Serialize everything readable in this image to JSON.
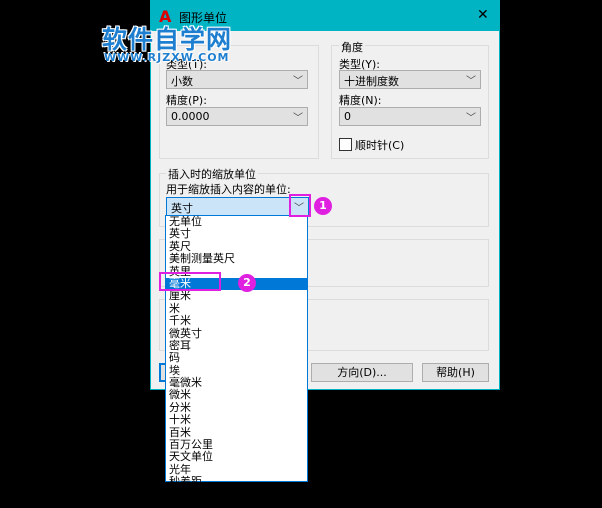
{
  "window": {
    "title": "图形单位",
    "close": "✕"
  },
  "watermark": {
    "name": "软件自学网",
    "url": "WWW.RJZXW.COM"
  },
  "length": {
    "type_label": "类型(T):",
    "type_value": "小数",
    "precision_label": "精度(P):",
    "precision_value": "0.0000"
  },
  "angle": {
    "group": "角度",
    "type_label": "类型(Y):",
    "type_value": "十进制度数",
    "precision_label": "精度(N):",
    "precision_value": "0",
    "clockwise_label": "顺时针(C)",
    "clockwise_checked": false
  },
  "insert": {
    "group": "插入时的缩放单位",
    "label": "用于缩放插入内容的单位:",
    "value": "英寸"
  },
  "dropdown": {
    "items": [
      "无单位",
      "英寸",
      "英尺",
      "美制测量英尺",
      "英里",
      "毫米",
      "厘米",
      "米",
      "千米",
      "微英寸",
      "密耳",
      "码",
      "埃",
      "毫微米",
      "微米",
      "分米",
      "十米",
      "百米",
      "百万公里",
      "天文单位",
      "光年",
      "秒差距"
    ],
    "selected": "毫米"
  },
  "buttons": {
    "direction": "方向(D)...",
    "help": "帮助(H)"
  },
  "annotations": {
    "step1": "1",
    "step2": "2"
  },
  "colors": {
    "titlebar": "#00b4c4",
    "highlight": "#0078d7",
    "marker": "#e020e0"
  }
}
